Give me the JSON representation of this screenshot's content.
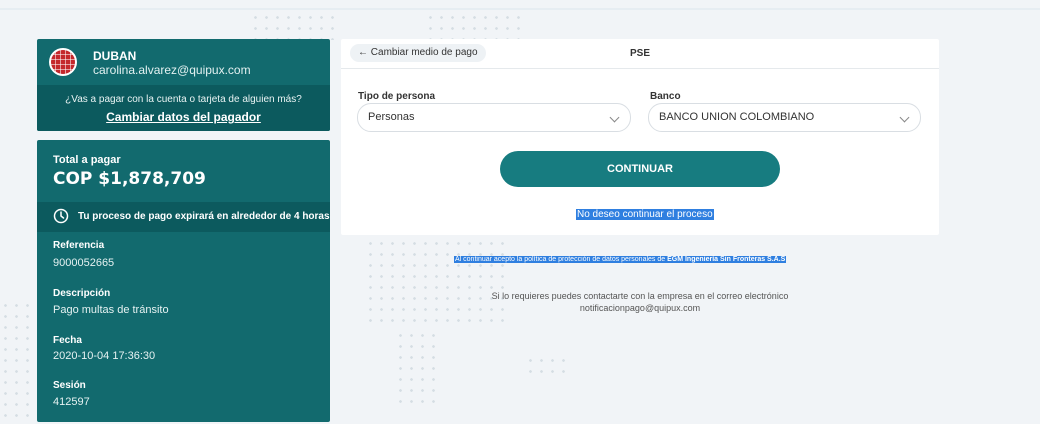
{
  "payer": {
    "name": "DUBAN",
    "email": "carolina.alvarez@quipux.com",
    "question": "¿Vas a pagar con la cuenta o tarjeta de alguien más?",
    "change_link": "Cambiar datos del pagador"
  },
  "summary": {
    "total_label": "Total a pagar",
    "total_amount": "COP $1,878,709",
    "expire_text": "Tu proceso de pago expirará en alrededor de 4 horas",
    "fields": [
      {
        "label": "Referencia",
        "value": "9000052665"
      },
      {
        "label": "Descripción",
        "value": "Pago multas de tránsito"
      },
      {
        "label": "Fecha",
        "value": "2020-10-04 17:36:30"
      },
      {
        "label": "Sesión",
        "value": "412597"
      }
    ]
  },
  "header": {
    "back_label": "Cambiar medio de pago",
    "title": "PSE"
  },
  "form": {
    "person_type_label": "Tipo de persona",
    "person_type_value": "Personas",
    "bank_label": "Banco",
    "bank_value": "BANCO UNION COLOMBIANO",
    "continue_label": "CONTINUAR",
    "cancel_label": "No deseo continuar el proceso"
  },
  "footer": {
    "policy_text": "Al continuar acepto la política de protección de datos personales de ",
    "policy_company": "EGM Ingeniería Sin Fronteras S.A.S",
    "contact_line1": "Si lo requieres puedes contactarte con la empresa en el correo electrónico",
    "contact_email": "notificacionpago@quipux.com"
  },
  "colors": {
    "accent": "#126a6e",
    "accent_dark": "#0c5a5e",
    "button": "#177c80",
    "highlight": "#2f7fe0"
  }
}
